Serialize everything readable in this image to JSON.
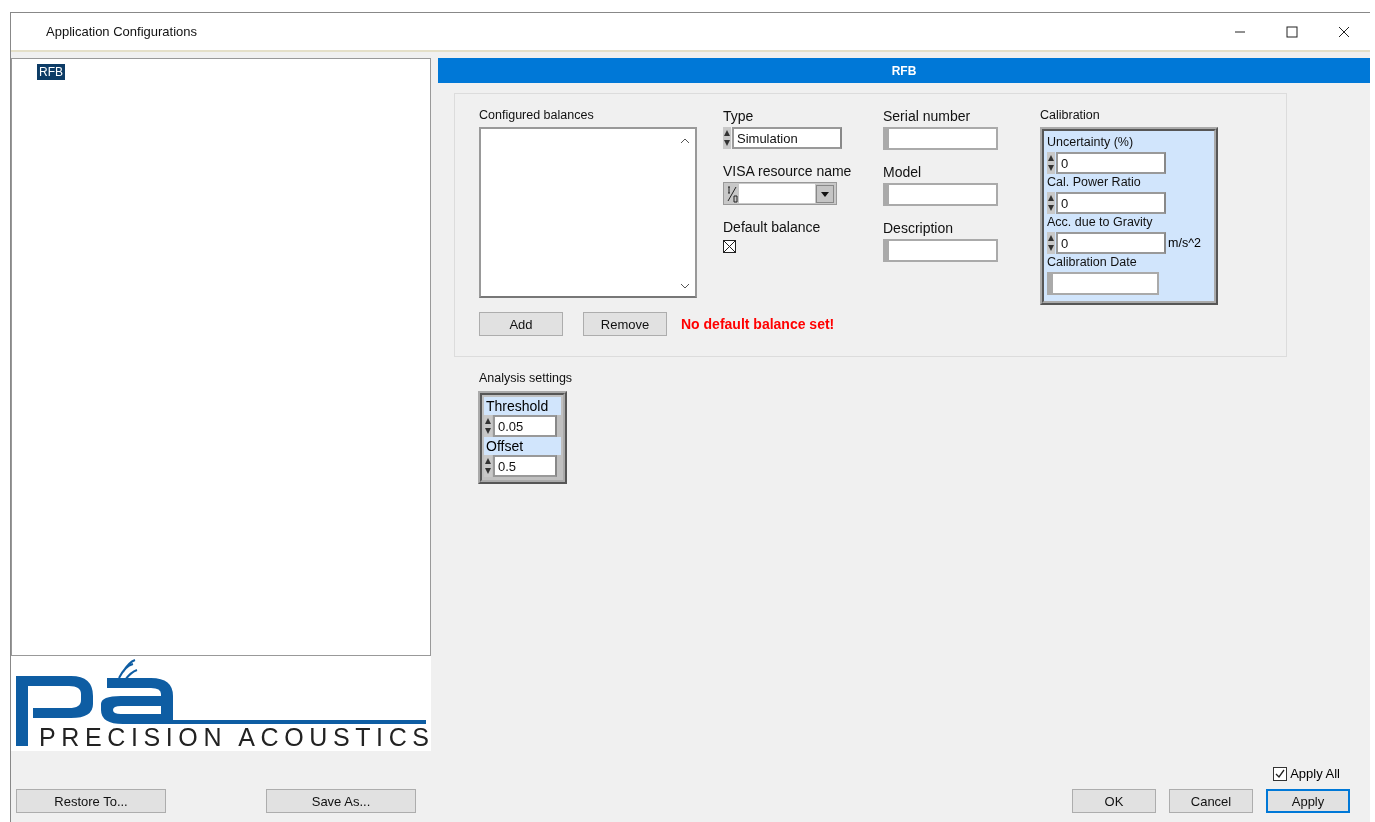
{
  "window": {
    "title": "Application Configurations"
  },
  "tree": {
    "items": [
      {
        "label": "RFB",
        "selected": true
      }
    ]
  },
  "logo": {
    "text": "PRECISION ACOUSTICS"
  },
  "left_buttons": [
    "Restore To...",
    "Save As..."
  ],
  "panel": {
    "header": "RFB"
  },
  "balances": {
    "label": "Configured balances",
    "buttons": [
      "Add",
      "Remove"
    ],
    "warning": "No default balance set!"
  },
  "type": {
    "label": "Type",
    "value": "Simulation"
  },
  "visa": {
    "label": "VISA resource name"
  },
  "default_balance": {
    "label": "Default balance",
    "checked": true
  },
  "text_fields": [
    {
      "label": "Serial number"
    },
    {
      "label": "Model"
    },
    {
      "label": "Description"
    }
  ],
  "calibration": {
    "label": "Calibration",
    "fields": [
      {
        "kind": "numeric",
        "label": "Uncertainty (%)",
        "value": "0"
      },
      {
        "kind": "numeric",
        "label": "Cal. Power Ratio",
        "value": "0"
      },
      {
        "kind": "numeric",
        "label": "Acc. due to Gravity",
        "value": "0",
        "unit": "m/s^2"
      },
      {
        "kind": "text",
        "label": "Calibration Date"
      }
    ]
  },
  "analysis": {
    "label": "Analysis settings",
    "fields": [
      {
        "label": "Threshold",
        "value": "0.05"
      },
      {
        "label": "Offset",
        "value": "0.5"
      }
    ]
  },
  "apply_all": {
    "label": "Apply All",
    "checked": true
  },
  "dialog_buttons": [
    {
      "label": "OK",
      "focused": false
    },
    {
      "label": "Cancel",
      "focused": false
    },
    {
      "label": "Apply",
      "focused": true
    }
  ]
}
